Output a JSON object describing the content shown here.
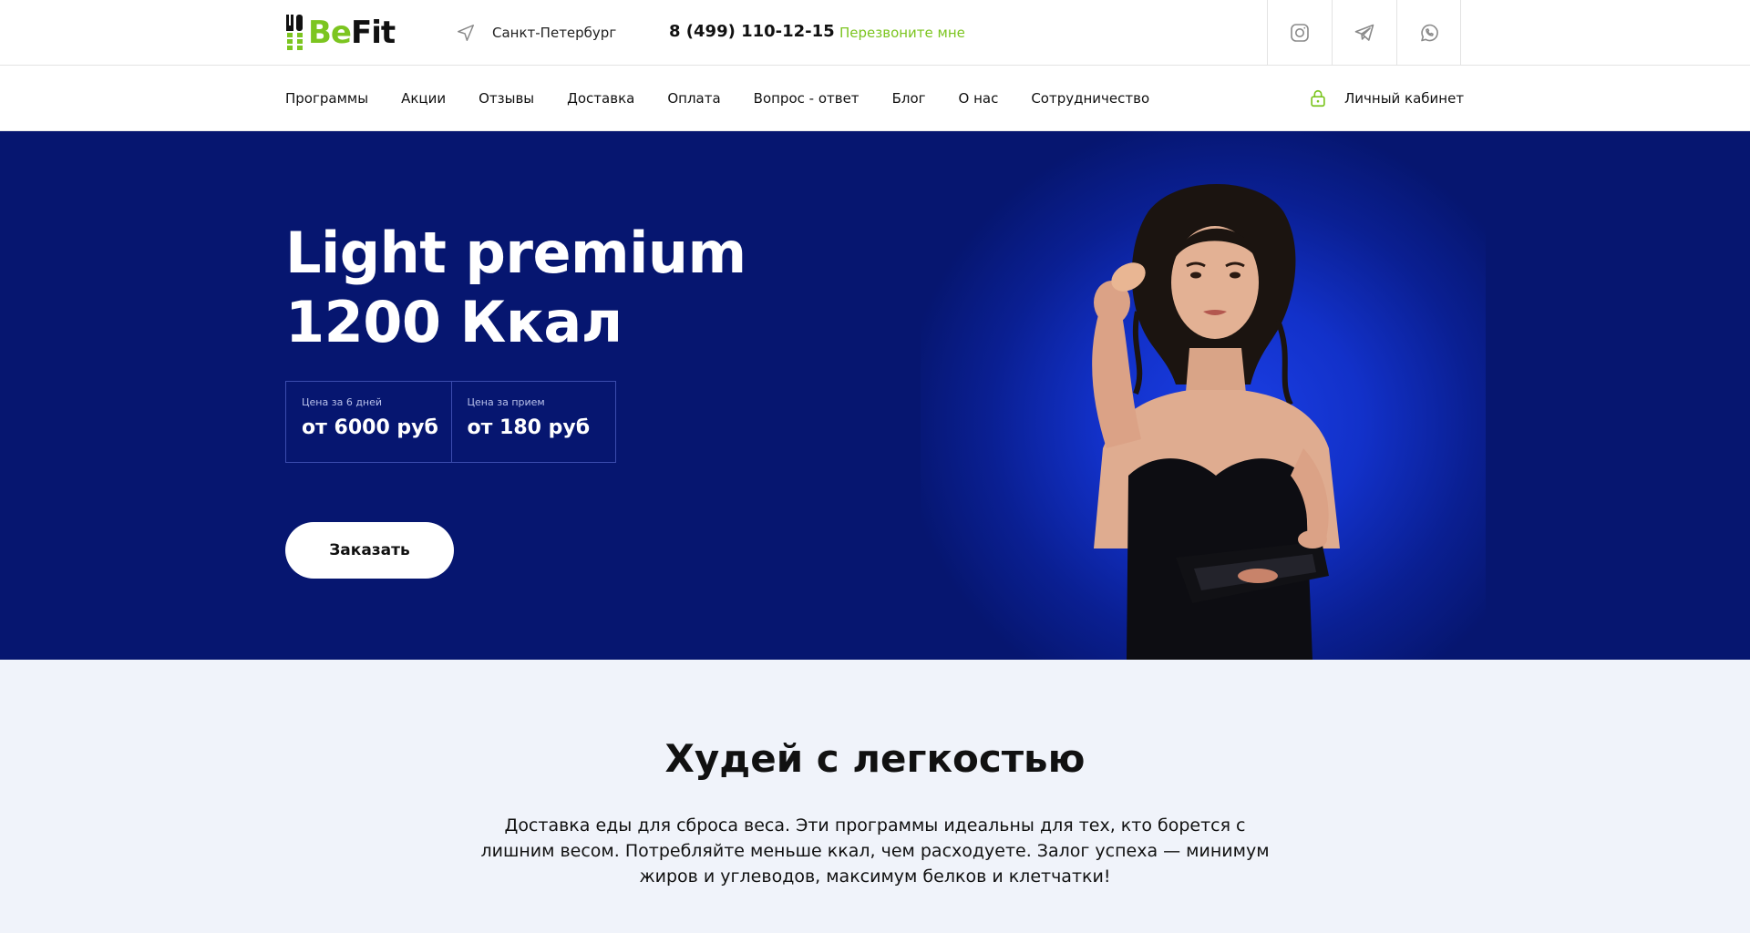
{
  "header": {
    "logo": {
      "part1": "Be",
      "part2": "Fit"
    },
    "city": "Санкт-Петербург",
    "phone": "8 (499) 110-12-15",
    "callback_label": "Перезвоните мне",
    "socials": [
      "instagram-icon",
      "telegram-icon",
      "whatsapp-icon"
    ]
  },
  "nav": {
    "items": [
      {
        "label": "Программы"
      },
      {
        "label": "Акции"
      },
      {
        "label": "Отзывы"
      },
      {
        "label": "Доставка"
      },
      {
        "label": "Оплата"
      },
      {
        "label": "Вопрос - ответ"
      },
      {
        "label": "Блог"
      },
      {
        "label": "О нас"
      },
      {
        "label": "Сотрудничество"
      }
    ],
    "cabinet_label": "Личный кабинет"
  },
  "hero": {
    "title_line1": "Light premium",
    "title_line2": "1200 Ккал",
    "prices": [
      {
        "label": "Цена за 6 дней",
        "value": "от 6000 руб"
      },
      {
        "label": "Цена за прием",
        "value": "от 180 руб"
      }
    ],
    "order_label": "Заказать"
  },
  "intro": {
    "title": "Худей с легкостью",
    "text": "Доставка еды для сброса веса. Эти программы идеальны для тех, кто борется с лишним весом. Потребляйте меньше ккал, чем расходуете. Залог успеха — минимум жиров и углеводов, максимум белков и клетчатки!"
  },
  "colors": {
    "accent": "#7cc520",
    "hero_bg": "#061670",
    "intro_bg": "#f0f3fa"
  }
}
